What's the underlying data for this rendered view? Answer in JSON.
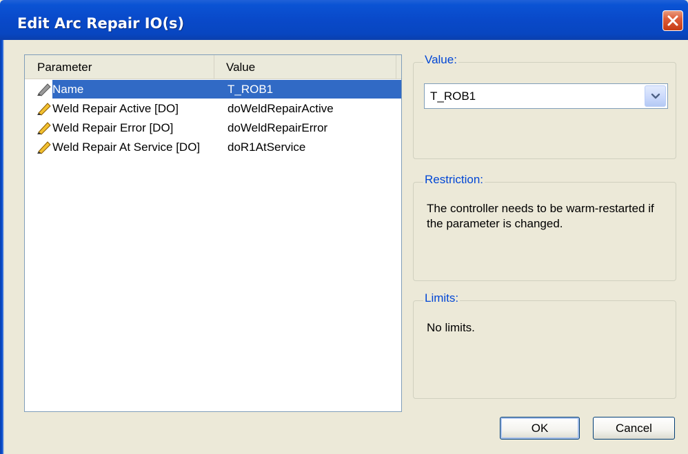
{
  "window": {
    "title": "Edit Arc Repair IO(s)",
    "close_icon": "close-icon"
  },
  "list": {
    "columns": [
      "Parameter",
      "Value"
    ],
    "rows": [
      {
        "parameter": "Name",
        "value": "T_ROB1",
        "icon": "pencil-icon",
        "selected": true
      },
      {
        "parameter": "Weld Repair Active [DO]",
        "value": "doWeldRepairActive",
        "icon": "pencil-icon",
        "selected": false
      },
      {
        "parameter": "Weld Repair Error [DO]",
        "value": "doWeldRepairError",
        "icon": "pencil-icon",
        "selected": false
      },
      {
        "parameter": "Weld Repair At Service [DO]",
        "value": "doR1AtService",
        "icon": "pencil-icon",
        "selected": false
      }
    ]
  },
  "value_group": {
    "legend": "Value:",
    "selected": "T_ROB1"
  },
  "restriction_group": {
    "legend": "Restriction:",
    "text_line1": "The controller needs to be warm-restarted if",
    "text_line2": "the parameter is changed."
  },
  "limits_group": {
    "legend": "Limits:",
    "text": "No limits."
  },
  "buttons": {
    "ok": "OK",
    "cancel": "Cancel"
  },
  "colors": {
    "titlebar": "#0a53d4",
    "selection": "#316ac5",
    "legend": "#0046d5",
    "dialog_bg": "#ece9d8"
  }
}
